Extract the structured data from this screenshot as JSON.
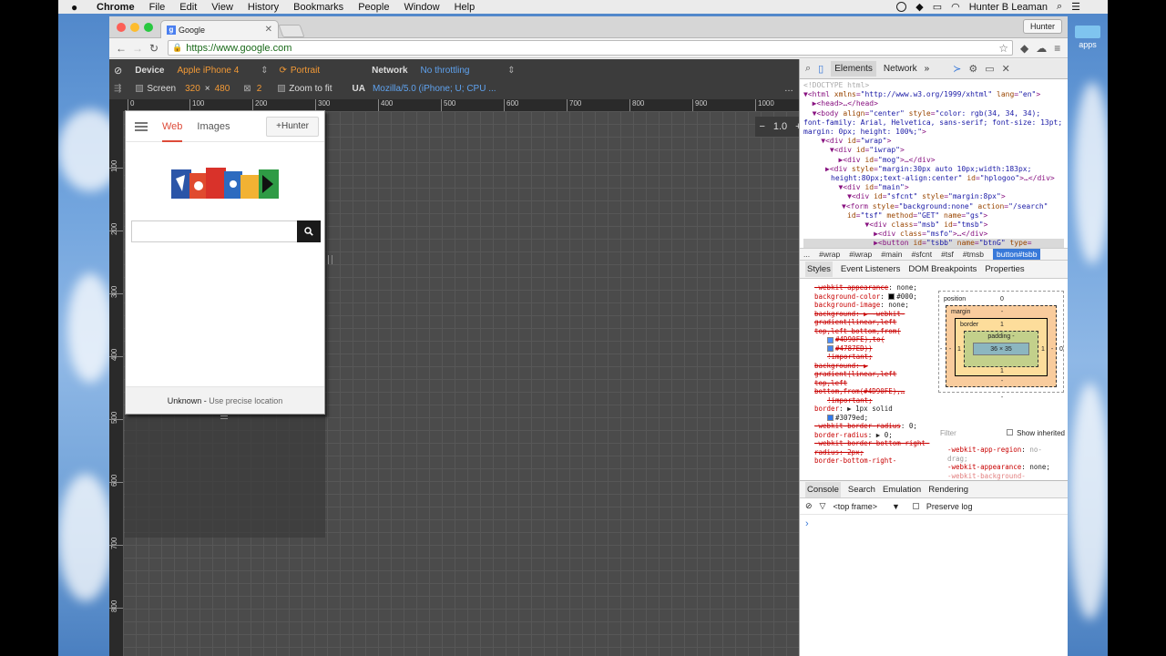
{
  "menubar": {
    "app": "Chrome",
    "items": [
      "File",
      "Edit",
      "View",
      "History",
      "Bookmarks",
      "People",
      "Window",
      "Help"
    ],
    "user": "Hunter B Leaman"
  },
  "browser": {
    "tab_title": "Google",
    "tab_favicon": "g",
    "profile": "Hunter",
    "url": "https://www.google.com"
  },
  "emulation": {
    "device_label": "Device",
    "device_value": "Apple iPhone 4",
    "orientation": "Portrait",
    "network_label": "Network",
    "network_value": "No throttling",
    "screen_label": "Screen",
    "width": "320",
    "times": "×",
    "height": "480",
    "dpr": "2",
    "zoom_to_fit": "Zoom to fit",
    "ua_label": "UA",
    "ua_value": "Mozilla/5.0 (iPhone; U; CPU ...",
    "zoom_value": "1.0",
    "zoom_minus": "−",
    "zoom_plus": "+",
    "ruler_top": [
      "0",
      "100",
      "200",
      "300",
      "400",
      "500",
      "600",
      "700",
      "800",
      "900",
      "1000"
    ],
    "ruler_left": [
      "100",
      "200",
      "300",
      "400",
      "500",
      "600",
      "700",
      "800"
    ]
  },
  "google": {
    "tab_web": "Web",
    "tab_images": "Images",
    "signin": "+Hunter",
    "footer_location": "Unknown",
    "footer_sep": " - ",
    "footer_link": "Use precise location"
  },
  "devtools": {
    "tabs": [
      "Elements",
      "Network"
    ],
    "more": "»",
    "crumbs_prefix": "...",
    "crumbs": [
      "#wrap",
      "#iwrap",
      "#main",
      "#sfcnt",
      "#tsf",
      "#tmsb"
    ],
    "crumb_current": "button#tsbb",
    "subtabs": [
      "Styles",
      "Event Listeners",
      "DOM Breakpoints",
      "Properties"
    ],
    "box": {
      "position_label": "position",
      "position_value": "0",
      "margin_label": "margin",
      "margin_value": "-",
      "border_label": "border",
      "border_value": "1",
      "padding_label": "padding -",
      "content": "36 × 35",
      "side_left": "1",
      "side_right": "1",
      "dash": "-",
      "outer": "0"
    },
    "filter_placeholder": "Filter",
    "show_inherited": "Show inherited",
    "computed": [
      {
        "p": "-webkit-app-region",
        "v": "no-drag;"
      },
      {
        "p": "-webkit-appearance",
        "v": "none;"
      },
      {
        "p": "-webkit-background-",
        "v": ""
      }
    ],
    "drawer_tabs": [
      "Console",
      "Search",
      "Emulation",
      "Rendering"
    ],
    "frame": "<top frame>",
    "preserve_log": "Preserve log",
    "prompt": "›"
  },
  "desktop": {
    "apps_label": "apps"
  },
  "colors": {
    "accent_orange": "#f39a36",
    "accent_blue": "#5fa2ee",
    "google_red": "#dd4b39",
    "crumb_selected": "#3879d9"
  }
}
